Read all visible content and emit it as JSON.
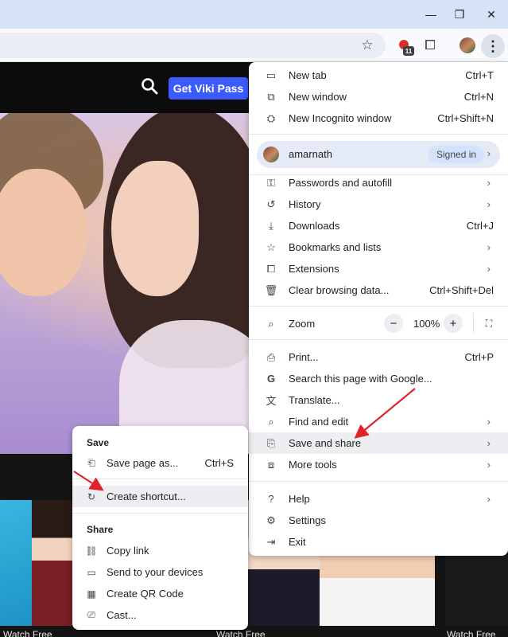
{
  "page": {
    "cta_label": "Get Viki Pass",
    "watch_labels": [
      "Watch Free",
      "Watch Free",
      "Watch Free"
    ]
  },
  "toolbar": {
    "extension_badge": "11",
    "icons": [
      "star-icon",
      "extensions-icon",
      "profile-avatar",
      "kebab-icon"
    ]
  },
  "menu": {
    "items_top": [
      {
        "icon": "new-tab-icon",
        "glyph": "▭",
        "label": "New tab",
        "shortcut": "Ctrl+T"
      },
      {
        "icon": "new-window-icon",
        "glyph": "⧉",
        "label": "New window",
        "shortcut": "Ctrl+N"
      },
      {
        "icon": "incognito-icon",
        "glyph": "⛭",
        "label": "New Incognito window",
        "shortcut": "Ctrl+Shift+N"
      }
    ],
    "profile": {
      "name": "amarnath",
      "status": "Signed in"
    },
    "items_mid": [
      {
        "icon": "key-icon",
        "glyph": "⚿",
        "label": "Passwords and autofill",
        "submenu": true
      },
      {
        "icon": "history-icon",
        "glyph": "↺",
        "label": "History",
        "submenu": true
      },
      {
        "icon": "download-icon",
        "glyph": "⤓",
        "label": "Downloads",
        "shortcut": "Ctrl+J"
      },
      {
        "icon": "star-icon",
        "glyph": "☆",
        "label": "Bookmarks and lists",
        "submenu": true
      },
      {
        "icon": "puzzle-icon",
        "glyph": "⧠",
        "label": "Extensions",
        "submenu": true
      },
      {
        "icon": "trash-icon",
        "glyph": "🗑",
        "label": "Clear browsing data...",
        "shortcut": "Ctrl+Shift+Del"
      }
    ],
    "zoom": {
      "label": "Zoom",
      "value": "100%",
      "minus": "−",
      "plus": "+"
    },
    "items_tools": [
      {
        "icon": "print-icon",
        "glyph": "⎙",
        "label": "Print...",
        "shortcut": "Ctrl+P"
      },
      {
        "icon": "google-icon",
        "glyph": "G",
        "label": "Search this page with Google..."
      },
      {
        "icon": "translate-icon",
        "glyph": "文",
        "label": "Translate..."
      },
      {
        "icon": "find-icon",
        "glyph": "⌕",
        "label": "Find and edit",
        "submenu": true
      },
      {
        "icon": "save-share-icon",
        "glyph": "⎘",
        "label": "Save and share",
        "submenu": true
      },
      {
        "icon": "toolbox-icon",
        "glyph": "⧈",
        "label": "More tools",
        "submenu": true
      }
    ],
    "items_bottom": [
      {
        "icon": "help-icon",
        "glyph": "?",
        "label": "Help",
        "submenu": true
      },
      {
        "icon": "settings-icon",
        "glyph": "⚙",
        "label": "Settings"
      },
      {
        "icon": "exit-icon",
        "glyph": "⇥",
        "label": "Exit"
      }
    ]
  },
  "submenu": {
    "save_header": "Save",
    "save_page": {
      "label": "Save page as...",
      "shortcut": "Ctrl+S"
    },
    "create_shortcut": {
      "label": "Create shortcut..."
    },
    "share_header": "Share",
    "share_items": [
      {
        "icon": "link-icon",
        "glyph": "⛓",
        "label": "Copy link"
      },
      {
        "icon": "devices-icon",
        "glyph": "▭",
        "label": "Send to your devices"
      },
      {
        "icon": "qr-icon",
        "glyph": "▦",
        "label": "Create QR Code"
      },
      {
        "icon": "cast-icon",
        "glyph": "⎚",
        "label": "Cast..."
      }
    ]
  },
  "colors": {
    "accent": "#3c5bff",
    "annotation": "#e0232b",
    "menu_highlight": "#eceef1"
  }
}
